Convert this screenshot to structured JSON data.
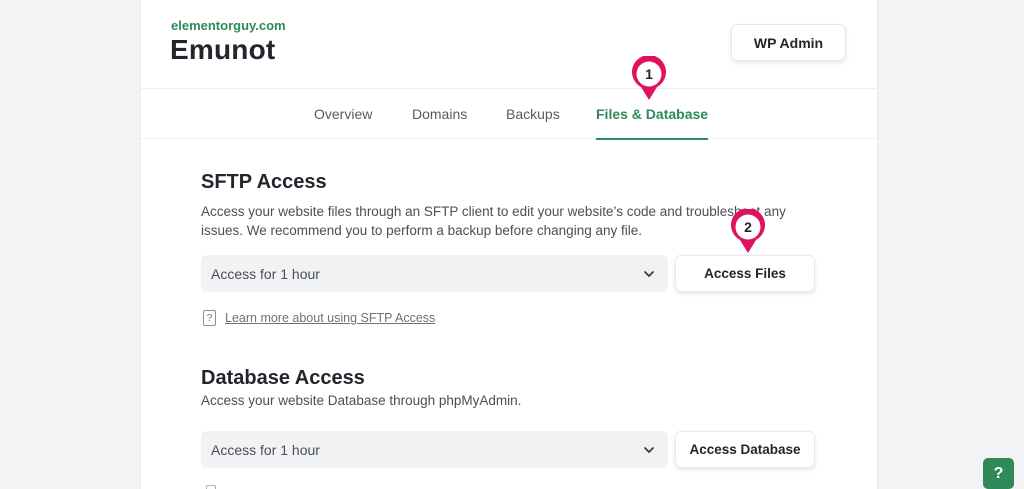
{
  "site": {
    "domain": "elementorguy.com",
    "name": "Emunot"
  },
  "header": {
    "wp_admin_label": "WP Admin"
  },
  "tabs": [
    {
      "label": "Overview",
      "active": false
    },
    {
      "label": "Domains",
      "active": false
    },
    {
      "label": "Backups",
      "active": false
    },
    {
      "label": "Files & Database",
      "active": true
    }
  ],
  "sftp": {
    "title": "SFTP Access",
    "description": "Access your website files through an SFTP client to edit your website’s code and troubleshoot any issues. We recommend you to perform a backup before changing any file.",
    "select_value": "Access for 1 hour",
    "button_label": "Access Files",
    "learn_more": "Learn more about using SFTP Access",
    "help_glyph": "?"
  },
  "database": {
    "title": "Database Access",
    "description": "Access your website Database through phpMyAdmin.",
    "select_value": "Access for 1 hour",
    "button_label": "Access Database"
  },
  "markers": [
    {
      "number": "1"
    },
    {
      "number": "2"
    }
  ],
  "help_button": {
    "label": "?"
  },
  "colors": {
    "accent": "#2f8a5a",
    "marker": "#e0115f",
    "page_bg": "#f2f3f4"
  },
  "icons": {
    "select_chevron": "chevron-down-icon",
    "learn_more": "question-doc-icon",
    "marker": "map-pin-marker-icon"
  }
}
